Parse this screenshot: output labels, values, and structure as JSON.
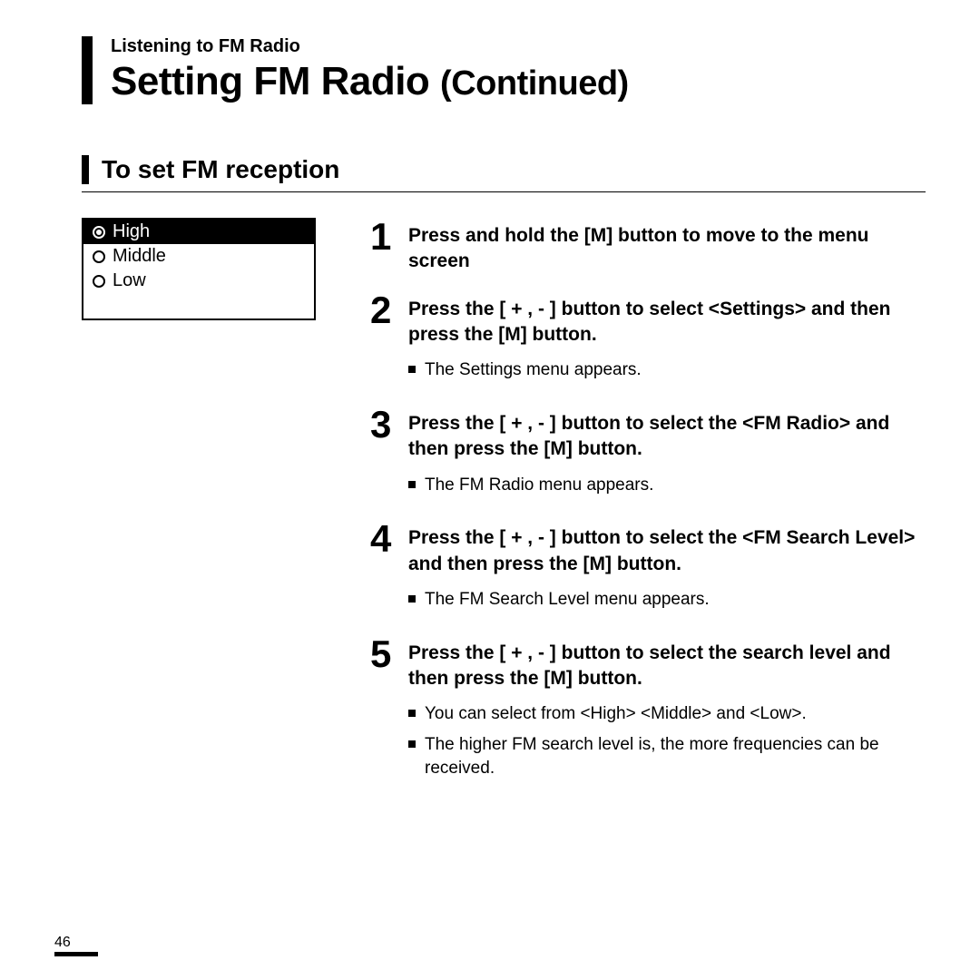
{
  "header": {
    "chapter": "Listening to FM Radio",
    "title_main": "Setting FM Radio",
    "title_cont": "(Continued)"
  },
  "section": {
    "title": "To set FM reception"
  },
  "menu": {
    "items": [
      {
        "label": "High",
        "selected": true
      },
      {
        "label": "Middle",
        "selected": false
      },
      {
        "label": "Low",
        "selected": false
      }
    ]
  },
  "steps": [
    {
      "num": "1",
      "main_pre": "Press and hold the [",
      "main_btn": "M",
      "main_post": "] button to move to the menu screen",
      "subs": []
    },
    {
      "num": "2",
      "main_pre": "Press the [ + , - ] button to select <Settings> and then press the [",
      "main_btn": "M",
      "main_post": "] button.",
      "subs": [
        "The Settings menu appears."
      ]
    },
    {
      "num": "3",
      "main_pre": "Press the [ + , - ] button to select the <FM Radio> and then press the [",
      "main_btn": "M",
      "main_post": "] button.",
      "subs": [
        "The FM Radio menu appears."
      ]
    },
    {
      "num": "4",
      "main_pre": "Press the [ + , - ] button to select the <FM Search Level> and then press the [",
      "main_btn": "M",
      "main_post": "] button.",
      "subs": [
        "The FM Search Level menu appears."
      ]
    },
    {
      "num": "5",
      "main_pre": "Press the [ + , - ] button to select the search level and then press the [",
      "main_btn": "M",
      "main_post": "] button.",
      "subs": [
        "You can select from <High> <Middle> and <Low>.",
        "The higher FM search level is, the more frequencies can be received."
      ]
    }
  ],
  "page_number": "46"
}
